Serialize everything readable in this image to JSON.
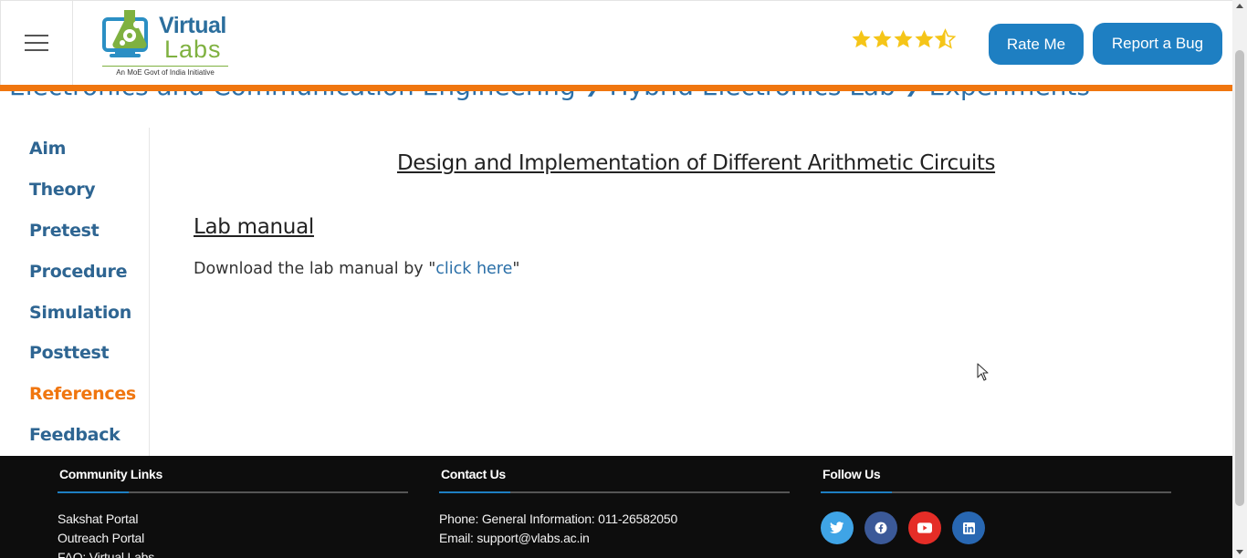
{
  "breadcrumb": {
    "items": [
      "Electronics and Communication Engineering",
      "Hybrid Electronics Lab",
      "Experiments"
    ],
    "separator": "❯"
  },
  "header": {
    "logo": {
      "word1": "Virtual",
      "word2": "Labs",
      "tagline": "An MoE Govt of India Initiative"
    },
    "rating": {
      "value": 4.5,
      "max": 5,
      "color": "#f5c518"
    },
    "rate_button": "Rate Me",
    "bug_button": "Report a Bug"
  },
  "sidebar": {
    "items": [
      {
        "label": "Aim",
        "active": false
      },
      {
        "label": "Theory",
        "active": false
      },
      {
        "label": "Pretest",
        "active": false
      },
      {
        "label": "Procedure",
        "active": false
      },
      {
        "label": "Simulation",
        "active": false
      },
      {
        "label": "Posttest",
        "active": false
      },
      {
        "label": "References",
        "active": true
      },
      {
        "label": "Feedback",
        "active": false
      }
    ]
  },
  "main": {
    "title": "Design and Implementation of Different Arithmetic Circuits",
    "section_heading": "Lab manual",
    "manual_prefix": "Download the lab manual by \"",
    "manual_link": "click here",
    "manual_suffix": "\""
  },
  "footer": {
    "community": {
      "heading": "Community Links",
      "links": [
        "Sakshat Portal",
        "Outreach Portal",
        "FAQ: Virtual Labs"
      ]
    },
    "contact": {
      "heading": "Contact Us",
      "phone": "Phone: General Information: 011-26582050",
      "email": "Email: support@vlabs.ac.in"
    },
    "follow": {
      "heading": "Follow Us",
      "icons": [
        {
          "name": "twitter-icon",
          "color": "#3fa4e6"
        },
        {
          "name": "facebook-icon",
          "color": "#3b5998"
        },
        {
          "name": "youtube-icon",
          "color": "#e52d27"
        },
        {
          "name": "linkedin-icon",
          "color": "#2867b2"
        }
      ]
    }
  },
  "colors": {
    "accent": "#1e7fc2",
    "orange": "#f0760f",
    "nav": "#2e6592",
    "footer_bg": "#0d0d0d"
  }
}
